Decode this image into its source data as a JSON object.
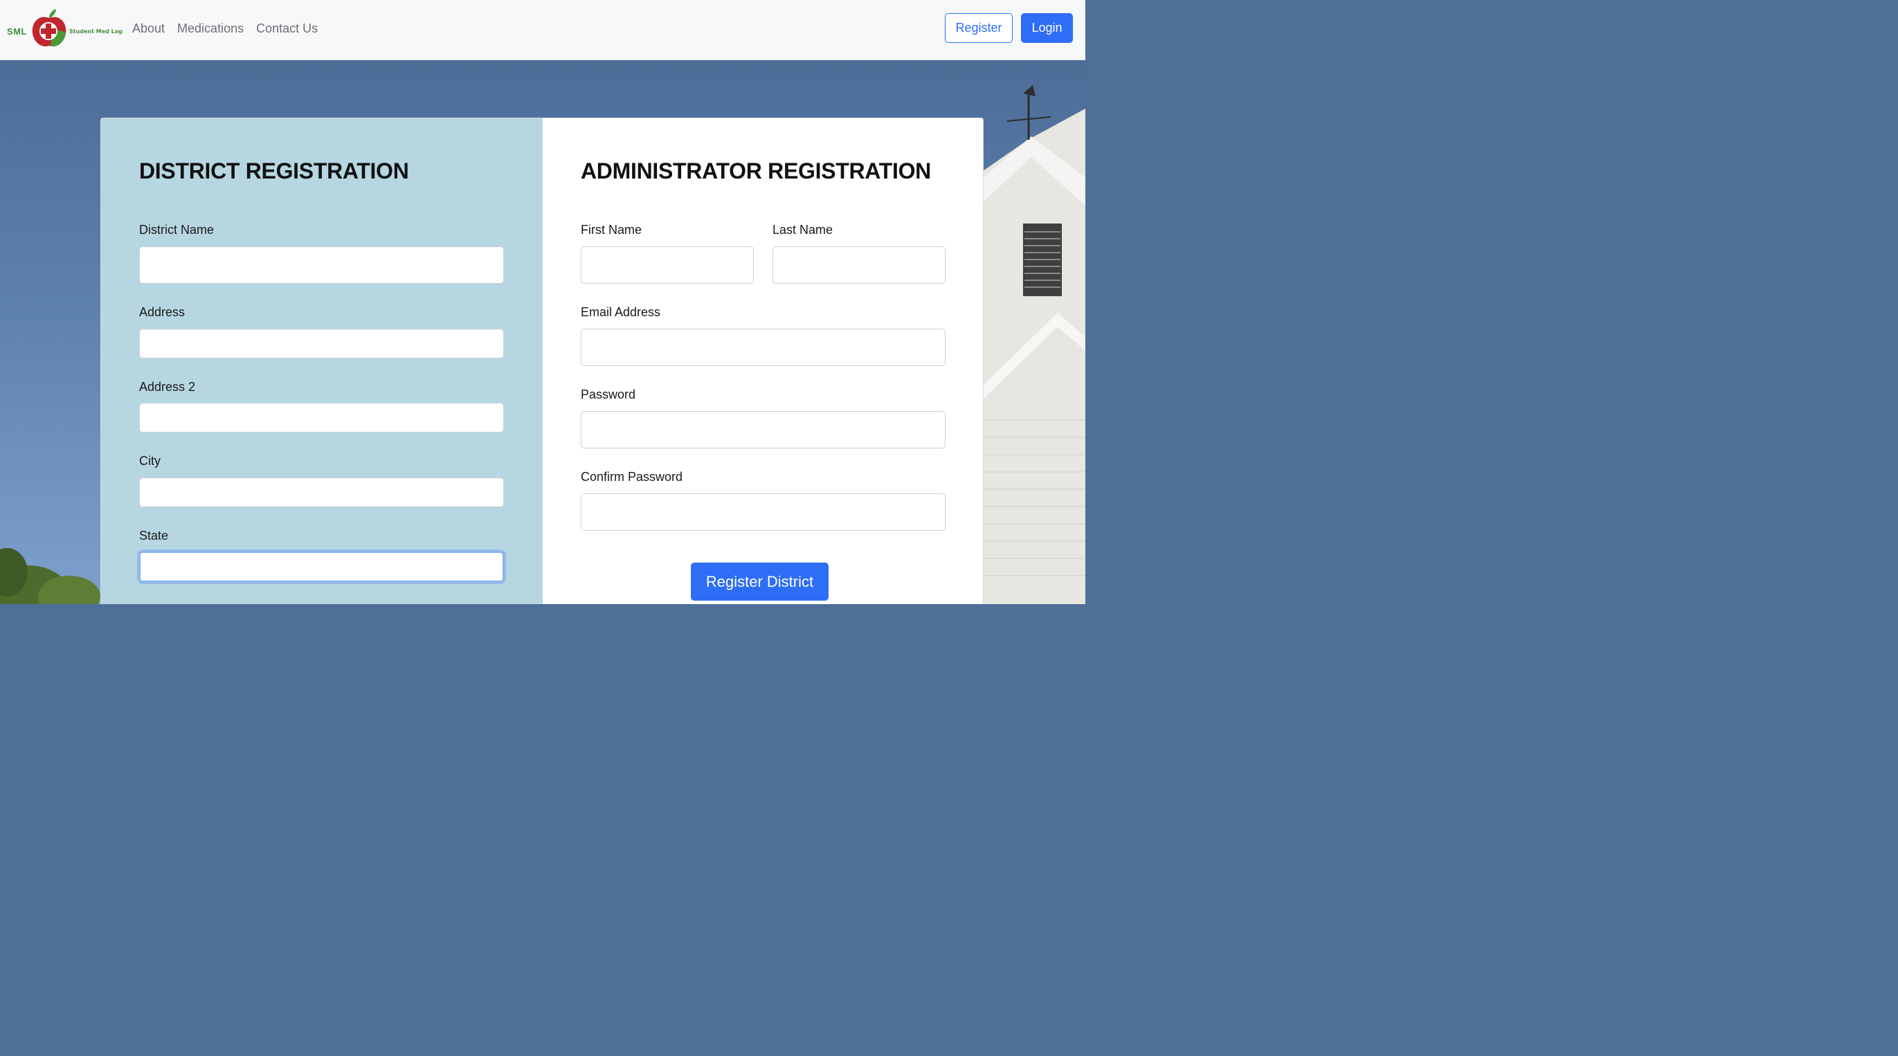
{
  "brand": {
    "short": "SML",
    "name": "Student Med Log",
    "colors": {
      "green": "#3f8f3a",
      "red": "#c0262d"
    }
  },
  "nav": {
    "links": [
      "About",
      "Medications",
      "Contact Us"
    ],
    "register_label": "Register",
    "login_label": "Login"
  },
  "district": {
    "title": "DISTRICT REGISTRATION",
    "fields": [
      {
        "label": "District Name",
        "value": ""
      },
      {
        "label": "Address",
        "value": ""
      },
      {
        "label": "Address 2",
        "value": ""
      },
      {
        "label": "City",
        "value": ""
      },
      {
        "label": "State",
        "value": ""
      }
    ]
  },
  "administrator": {
    "title": "ADMINISTRATOR REGISTRATION",
    "first_name_label": "First Name",
    "last_name_label": "Last Name",
    "email_label": "Email Address",
    "password_label": "Password",
    "confirm_password_label": "Confirm Password"
  },
  "submit_label": "Register District",
  "colors": {
    "accent": "#2e6df6",
    "left_pane": "#b6d7e2",
    "navbar": "#f7f8f9"
  }
}
